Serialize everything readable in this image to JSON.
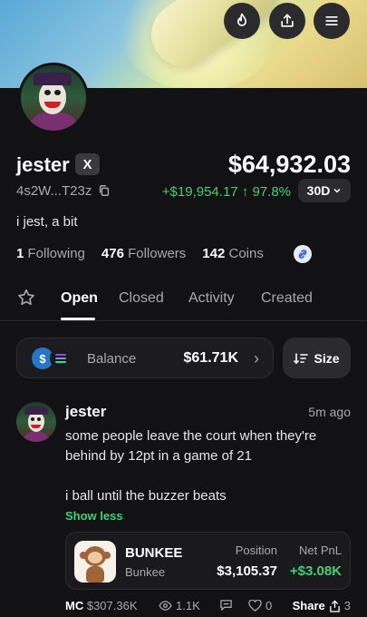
{
  "profile": {
    "username": "jester",
    "x_badge": "X",
    "address": "4s2W...T23z",
    "bio": "i jest, a bit",
    "portfolio_value": "$64,932.03",
    "pnl": "+$19,954.17 ↑ 97.8%",
    "period": "30D",
    "following_count": "1",
    "following_label": "Following",
    "followers_count": "476",
    "followers_label": "Followers",
    "coins_count": "142",
    "coins_label": "Coins"
  },
  "tabs": [
    {
      "label": "Open",
      "active": true
    },
    {
      "label": "Closed"
    },
    {
      "label": "Activity"
    },
    {
      "label": "Created"
    }
  ],
  "balance": {
    "label": "Balance",
    "value": "$61.71K",
    "usdc_symbol": "$"
  },
  "sort": {
    "label": "Size"
  },
  "post": {
    "author": "jester",
    "time": "5m ago",
    "line1": "some people leave the court when they're behind by 12pt in a game of 21",
    "line2": "i ball until the buzzer beats",
    "show_less": "Show less",
    "token": {
      "name": "BUNKEE",
      "subtitle": "Bunkee",
      "position_label": "Position",
      "position_value": "$3,105.37",
      "pnl_label": "Net PnL",
      "pnl_value": "+$3.08K"
    },
    "footer": {
      "mc_label": "MC",
      "mc_value": "$307.36K",
      "views": "1.1K",
      "likes": "0",
      "share_label": "Share",
      "share_count": "3"
    }
  },
  "colors": {
    "background": "#121214",
    "accent_green": "#3fd17a",
    "muted_text": "#a8a8ad",
    "button_bg": "#2b2b2e"
  },
  "icons": {
    "header_buttons": [
      "fire-icon",
      "share-upload-icon",
      "menu-icon"
    ]
  }
}
